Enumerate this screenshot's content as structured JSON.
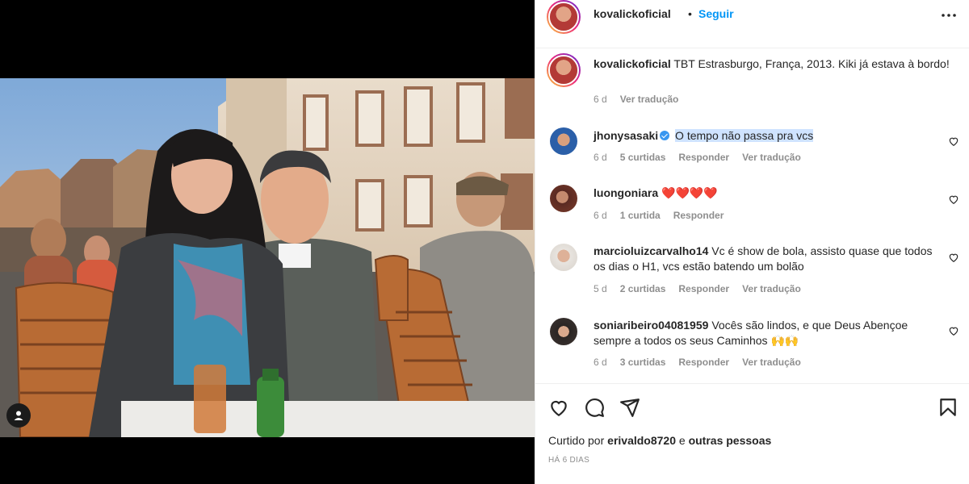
{
  "header": {
    "username": "kovalickoficial",
    "separator": "•",
    "follow_label": "Seguir",
    "more_icon": "more-horizontal-icon"
  },
  "caption": {
    "username": "kovalickoficial",
    "text": "TBT Estrasburgo, França, 2013. Kiki já estava à bordo!",
    "time": "6 d",
    "translate": "Ver tradução"
  },
  "comments": [
    {
      "username": "jhonysasaki",
      "verified": true,
      "text": "O tempo não passa pra vcs",
      "time": "6 d",
      "likes": "5 curtidas",
      "reply": "Responder",
      "translate": "Ver tradução"
    },
    {
      "username": "luongoniara",
      "text": "❤️❤️❤️❤️",
      "time": "6 d",
      "likes": "1 curtida",
      "reply": "Responder"
    },
    {
      "username": "marcioluizcarvalho14",
      "text": "Vc é show de bola, assisto quase que todos os dias o H1, vcs estão batendo um bolão",
      "time": "5 d",
      "likes": "2 curtidas",
      "reply": "Responder",
      "translate": "Ver tradução"
    },
    {
      "username": "soniaribeiro04081959",
      "text": "Vocês são lindos, e que Deus Abençoe sempre a todos os seus Caminhos 🙌🙌",
      "time": "6 d",
      "likes": "3 curtidas",
      "reply": "Responder",
      "translate": "Ver tradução"
    }
  ],
  "footer": {
    "liked_prefix": "Curtido por",
    "liked_user": "erivaldo8720",
    "liked_conj": "e",
    "liked_suffix": "outras pessoas",
    "ago": "HÁ 6 DIAS"
  },
  "colors": {
    "accent": "#0095f6",
    "text": "#262626",
    "muted": "#8e8e8e",
    "highlight": "#cfe3ff"
  }
}
